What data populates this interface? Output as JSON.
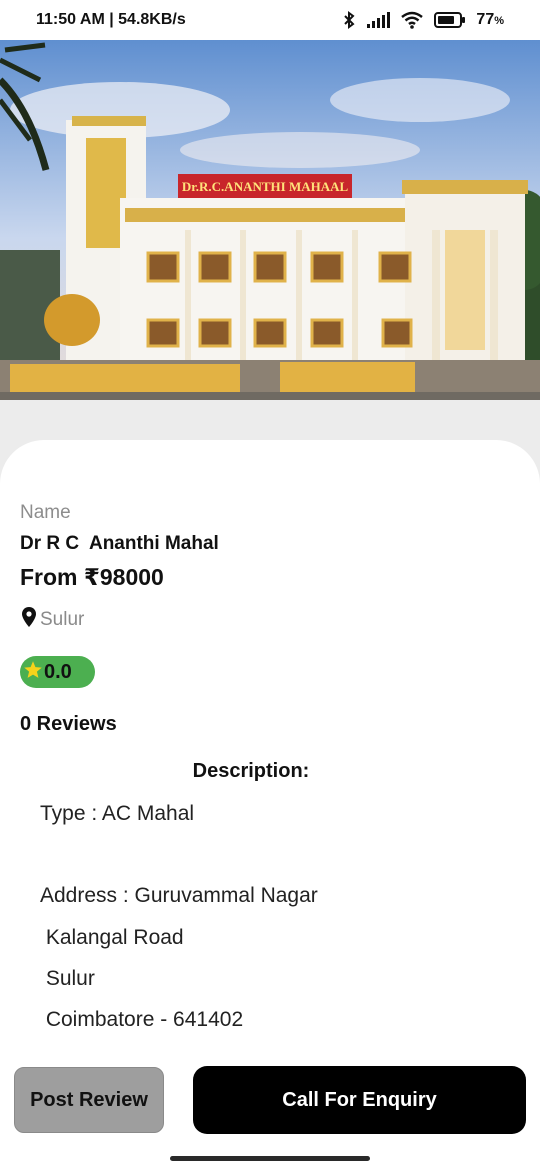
{
  "status_bar": {
    "time_speed": "11:50 AM | 54.8KB/s",
    "battery": "77"
  },
  "hero": {
    "sign_text": "Dr.R.C.ANANTHI MAHAAL"
  },
  "venue": {
    "name_label": "Name",
    "name": "Dr R C  Ananthi Mahal",
    "price": "From ₹98000",
    "location": "Sulur",
    "rating": "0.0",
    "reviews": "0 Reviews"
  },
  "description": {
    "title": "Description:",
    "lines": [
      "Type : AC Mahal",
      "Address : Guruvammal Nagar",
      " Kalangal Road",
      " Sulur",
      " Coimbatore - 641402"
    ]
  },
  "actions": {
    "post_review": "Post Review",
    "call_enquiry": "Call For Enquiry"
  },
  "colors": {
    "rating_badge": "#4caf50",
    "call_button": "#000000",
    "post_button": "#9e9e9e"
  },
  "icons": [
    "bluetooth-icon",
    "signal-icon",
    "wifi-icon",
    "battery-icon",
    "location-pin-icon",
    "star-icon"
  ]
}
